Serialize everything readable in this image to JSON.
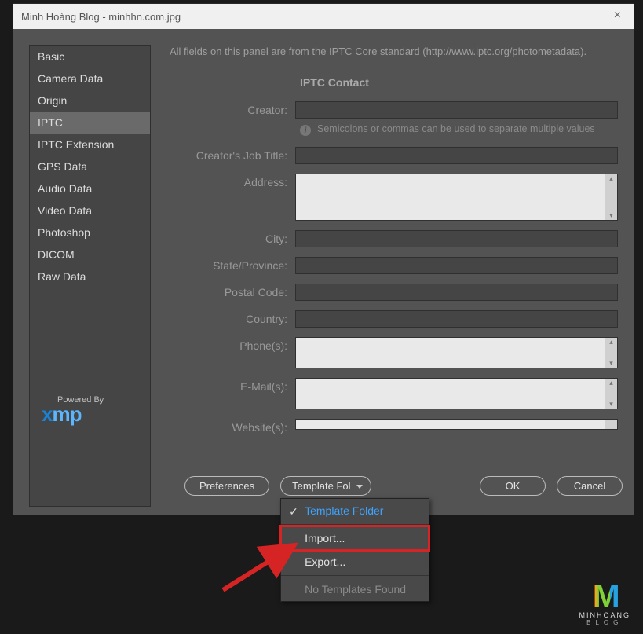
{
  "titlebar": {
    "text": "Minh Hoàng Blog - minhhn.com.jpg"
  },
  "intro": "All fields on this panel are from the IPTC Core standard (http://www.iptc.org/photometadata).",
  "sidebar": {
    "items": [
      {
        "label": "Basic"
      },
      {
        "label": "Camera Data"
      },
      {
        "label": "Origin"
      },
      {
        "label": "IPTC"
      },
      {
        "label": "IPTC Extension"
      },
      {
        "label": "GPS Data"
      },
      {
        "label": "Audio Data"
      },
      {
        "label": "Video Data"
      },
      {
        "label": "Photoshop"
      },
      {
        "label": "DICOM"
      },
      {
        "label": "Raw Data"
      }
    ],
    "selected_index": 3
  },
  "section": {
    "title": "IPTC Contact"
  },
  "fields": {
    "creator_label": "Creator:",
    "creator_hint": "Semicolons or commas can be used to separate multiple values",
    "job_title_label": "Creator's Job Title:",
    "address_label": "Address:",
    "city_label": "City:",
    "state_label": "State/Province:",
    "postal_label": "Postal Code:",
    "country_label": "Country:",
    "phones_label": "Phone(s):",
    "emails_label": "E-Mail(s):",
    "websites_label": "Website(s):"
  },
  "powered_by": "Powered By",
  "logo": {
    "x": "x",
    "mp": "mp"
  },
  "buttons": {
    "preferences": "Preferences",
    "ok": "OK",
    "cancel": "Cancel"
  },
  "dropdown": {
    "selected": "Template Fol",
    "items": [
      {
        "label": "Template Folder"
      },
      {
        "label": "Import..."
      },
      {
        "label": "Export..."
      },
      {
        "label": "No Templates Found"
      }
    ]
  },
  "watermark": {
    "m": "M",
    "name": "MINHOANG",
    "blog": "BLOG"
  }
}
